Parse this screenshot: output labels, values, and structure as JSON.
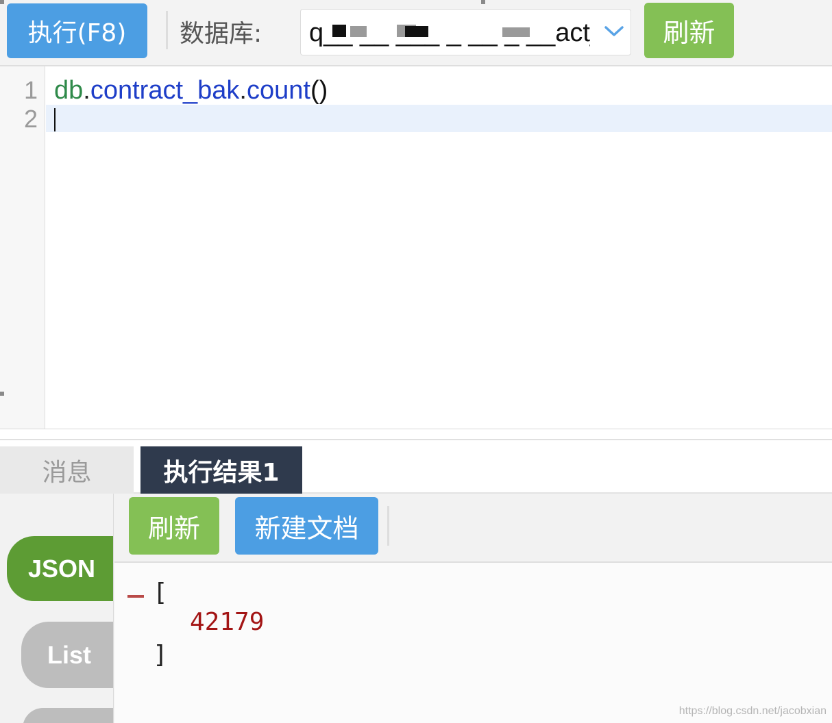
{
  "toolbar": {
    "run_label": "执行(F8)",
    "db_label": "数据库:",
    "db_value_visible": "q__ __ ___ _ __ _ __act_n",
    "refresh_label": "刷新"
  },
  "editor": {
    "lines": [
      {
        "number": "1",
        "var": "db",
        "dot1": ".",
        "collection": "contract_bak",
        "dot2": ".",
        "method": "count",
        "parens": "()"
      },
      {
        "number": "2"
      }
    ]
  },
  "tabs": {
    "messages": "消息",
    "result": "执行结果1"
  },
  "results": {
    "views": [
      "JSON",
      "List"
    ],
    "refresh_label": "刷新",
    "new_doc_label": "新建文档",
    "json_open": "[",
    "json_value": "42179",
    "json_close": "]"
  },
  "watermark": "https://blog.csdn.net/jacobxian",
  "colors": {
    "blue_button": "#4c9ee3",
    "green_button": "#84c055",
    "tab_active": "#2f3a4d",
    "json_view": "#5d9c34",
    "number_red": "#a31515"
  },
  "icons": [
    "chevron-down-icon",
    "collapse-toggle-icon"
  ]
}
